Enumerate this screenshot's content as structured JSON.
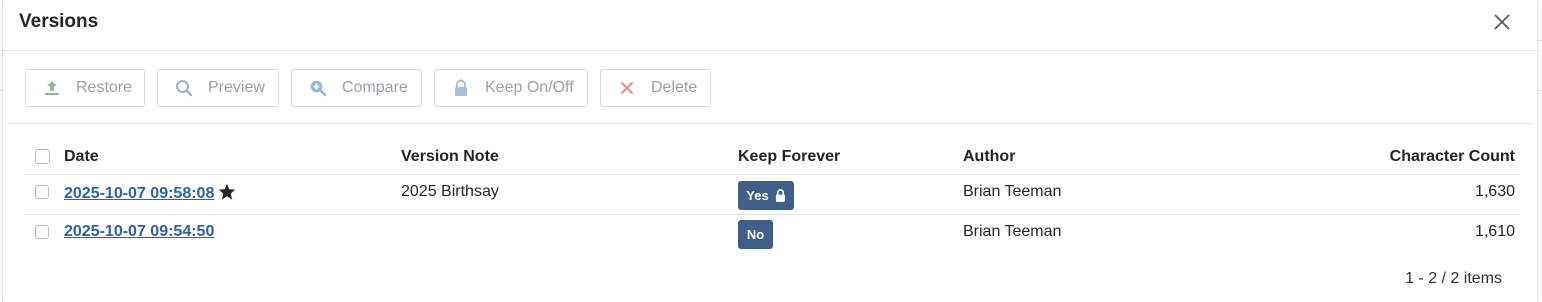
{
  "modal": {
    "title": "Versions"
  },
  "toolbar": {
    "buttons": [
      {
        "label": "Restore",
        "icon": "upload-icon"
      },
      {
        "label": "Preview",
        "icon": "search-icon"
      },
      {
        "label": "Compare",
        "icon": "zoom-in-icon"
      },
      {
        "label": "Keep On/Off",
        "icon": "lock-icon"
      },
      {
        "label": "Delete",
        "icon": "x-icon"
      }
    ]
  },
  "table": {
    "columns": [
      "Date",
      "Version Note",
      "Keep Forever",
      "Author",
      "Character Count"
    ],
    "rows": [
      {
        "date": "2025-10-07 09:58:08",
        "starred": true,
        "note": "2025 Birthsay",
        "keep": "Yes",
        "keep_locked": true,
        "author": "Brian Teeman",
        "count": "1,630"
      },
      {
        "date": "2025-10-07 09:54:50",
        "starred": false,
        "note": "",
        "keep": "No",
        "keep_locked": false,
        "author": "Brian Teeman",
        "count": "1,610"
      }
    ]
  },
  "pager": {
    "text": "1 - 2 / 2 items"
  },
  "colors": {
    "link": "#2b61a8",
    "badge": "#3f5f8a",
    "restore_icon": "#8fbc9a",
    "preview_icon": "#93b4d8",
    "lock_icon": "#a9bfd9",
    "delete_icon": "#e58a8a"
  }
}
